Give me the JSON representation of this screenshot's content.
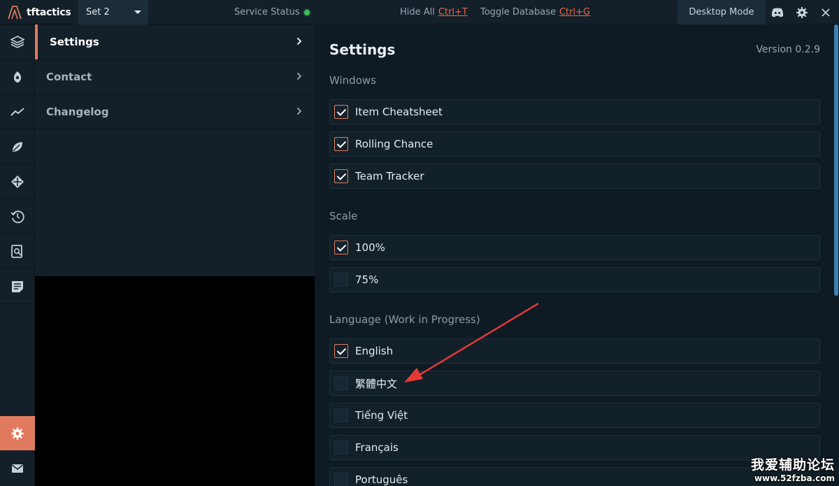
{
  "topbar": {
    "app_name": "tftactics",
    "set_select": "Set 2",
    "service_status": "Service Status",
    "hide_all_label": "Hide All",
    "hide_all_key": "Ctrl+T",
    "toggle_db_label": "Toggle Database",
    "toggle_db_key": "Ctrl+G",
    "desktop_mode": "Desktop Mode",
    "icons": [
      "discord-icon",
      "gear-icon",
      "close-icon"
    ]
  },
  "rail": {
    "items": [
      "layers-icon",
      "champion-icon",
      "trending-icon",
      "leaf-icon",
      "items-icon",
      "history-icon",
      "book-search-icon",
      "notes-icon"
    ],
    "bottom": [
      "settings-icon",
      "mail-icon"
    ],
    "active": "settings-icon"
  },
  "subnav": {
    "items": [
      {
        "label": "Settings",
        "active": true
      },
      {
        "label": "Contact",
        "active": false
      },
      {
        "label": "Changelog",
        "active": false
      }
    ]
  },
  "main": {
    "title": "Settings",
    "version": "Version 0.2.9",
    "sections": [
      {
        "label": "Windows",
        "options": [
          {
            "label": "Item Cheatsheet",
            "checked": true
          },
          {
            "label": "Rolling Chance",
            "checked": true
          },
          {
            "label": "Team Tracker",
            "checked": true
          }
        ]
      },
      {
        "label": "Scale",
        "options": [
          {
            "label": "100%",
            "checked": true
          },
          {
            "label": "75%",
            "checked": false
          }
        ]
      },
      {
        "label": "Language (Work in Progress)",
        "options": [
          {
            "label": "English",
            "checked": true
          },
          {
            "label": "繁體中文",
            "checked": false
          },
          {
            "label": "Tiếng Việt",
            "checked": false
          },
          {
            "label": "Français",
            "checked": false
          },
          {
            "label": "Português",
            "checked": false
          }
        ]
      }
    ]
  },
  "colors": {
    "accent": "#e07b5f",
    "status_online": "#3fbf5a",
    "annotation_arrow": "#e53935"
  },
  "watermark": {
    "line1": "我爱辅助论坛",
    "line2": "www.52fzba.com"
  }
}
